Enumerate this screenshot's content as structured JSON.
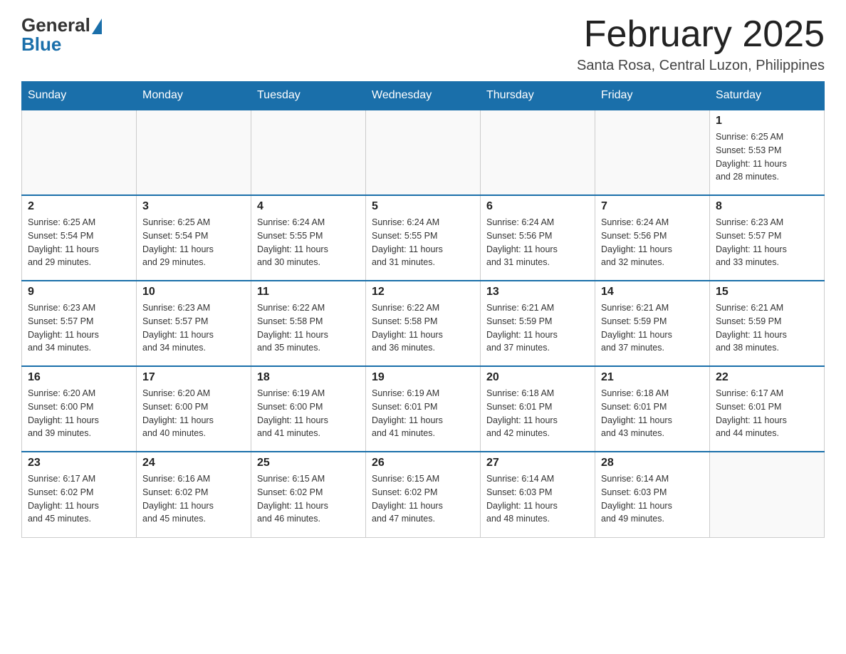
{
  "header": {
    "logo_general": "General",
    "logo_blue": "Blue",
    "month_title": "February 2025",
    "location": "Santa Rosa, Central Luzon, Philippines"
  },
  "weekdays": [
    "Sunday",
    "Monday",
    "Tuesday",
    "Wednesday",
    "Thursday",
    "Friday",
    "Saturday"
  ],
  "weeks": [
    [
      {
        "day": "",
        "info": ""
      },
      {
        "day": "",
        "info": ""
      },
      {
        "day": "",
        "info": ""
      },
      {
        "day": "",
        "info": ""
      },
      {
        "day": "",
        "info": ""
      },
      {
        "day": "",
        "info": ""
      },
      {
        "day": "1",
        "info": "Sunrise: 6:25 AM\nSunset: 5:53 PM\nDaylight: 11 hours\nand 28 minutes."
      }
    ],
    [
      {
        "day": "2",
        "info": "Sunrise: 6:25 AM\nSunset: 5:54 PM\nDaylight: 11 hours\nand 29 minutes."
      },
      {
        "day": "3",
        "info": "Sunrise: 6:25 AM\nSunset: 5:54 PM\nDaylight: 11 hours\nand 29 minutes."
      },
      {
        "day": "4",
        "info": "Sunrise: 6:24 AM\nSunset: 5:55 PM\nDaylight: 11 hours\nand 30 minutes."
      },
      {
        "day": "5",
        "info": "Sunrise: 6:24 AM\nSunset: 5:55 PM\nDaylight: 11 hours\nand 31 minutes."
      },
      {
        "day": "6",
        "info": "Sunrise: 6:24 AM\nSunset: 5:56 PM\nDaylight: 11 hours\nand 31 minutes."
      },
      {
        "day": "7",
        "info": "Sunrise: 6:24 AM\nSunset: 5:56 PM\nDaylight: 11 hours\nand 32 minutes."
      },
      {
        "day": "8",
        "info": "Sunrise: 6:23 AM\nSunset: 5:57 PM\nDaylight: 11 hours\nand 33 minutes."
      }
    ],
    [
      {
        "day": "9",
        "info": "Sunrise: 6:23 AM\nSunset: 5:57 PM\nDaylight: 11 hours\nand 34 minutes."
      },
      {
        "day": "10",
        "info": "Sunrise: 6:23 AM\nSunset: 5:57 PM\nDaylight: 11 hours\nand 34 minutes."
      },
      {
        "day": "11",
        "info": "Sunrise: 6:22 AM\nSunset: 5:58 PM\nDaylight: 11 hours\nand 35 minutes."
      },
      {
        "day": "12",
        "info": "Sunrise: 6:22 AM\nSunset: 5:58 PM\nDaylight: 11 hours\nand 36 minutes."
      },
      {
        "day": "13",
        "info": "Sunrise: 6:21 AM\nSunset: 5:59 PM\nDaylight: 11 hours\nand 37 minutes."
      },
      {
        "day": "14",
        "info": "Sunrise: 6:21 AM\nSunset: 5:59 PM\nDaylight: 11 hours\nand 37 minutes."
      },
      {
        "day": "15",
        "info": "Sunrise: 6:21 AM\nSunset: 5:59 PM\nDaylight: 11 hours\nand 38 minutes."
      }
    ],
    [
      {
        "day": "16",
        "info": "Sunrise: 6:20 AM\nSunset: 6:00 PM\nDaylight: 11 hours\nand 39 minutes."
      },
      {
        "day": "17",
        "info": "Sunrise: 6:20 AM\nSunset: 6:00 PM\nDaylight: 11 hours\nand 40 minutes."
      },
      {
        "day": "18",
        "info": "Sunrise: 6:19 AM\nSunset: 6:00 PM\nDaylight: 11 hours\nand 41 minutes."
      },
      {
        "day": "19",
        "info": "Sunrise: 6:19 AM\nSunset: 6:01 PM\nDaylight: 11 hours\nand 41 minutes."
      },
      {
        "day": "20",
        "info": "Sunrise: 6:18 AM\nSunset: 6:01 PM\nDaylight: 11 hours\nand 42 minutes."
      },
      {
        "day": "21",
        "info": "Sunrise: 6:18 AM\nSunset: 6:01 PM\nDaylight: 11 hours\nand 43 minutes."
      },
      {
        "day": "22",
        "info": "Sunrise: 6:17 AM\nSunset: 6:01 PM\nDaylight: 11 hours\nand 44 minutes."
      }
    ],
    [
      {
        "day": "23",
        "info": "Sunrise: 6:17 AM\nSunset: 6:02 PM\nDaylight: 11 hours\nand 45 minutes."
      },
      {
        "day": "24",
        "info": "Sunrise: 6:16 AM\nSunset: 6:02 PM\nDaylight: 11 hours\nand 45 minutes."
      },
      {
        "day": "25",
        "info": "Sunrise: 6:15 AM\nSunset: 6:02 PM\nDaylight: 11 hours\nand 46 minutes."
      },
      {
        "day": "26",
        "info": "Sunrise: 6:15 AM\nSunset: 6:02 PM\nDaylight: 11 hours\nand 47 minutes."
      },
      {
        "day": "27",
        "info": "Sunrise: 6:14 AM\nSunset: 6:03 PM\nDaylight: 11 hours\nand 48 minutes."
      },
      {
        "day": "28",
        "info": "Sunrise: 6:14 AM\nSunset: 6:03 PM\nDaylight: 11 hours\nand 49 minutes."
      },
      {
        "day": "",
        "info": ""
      }
    ]
  ]
}
